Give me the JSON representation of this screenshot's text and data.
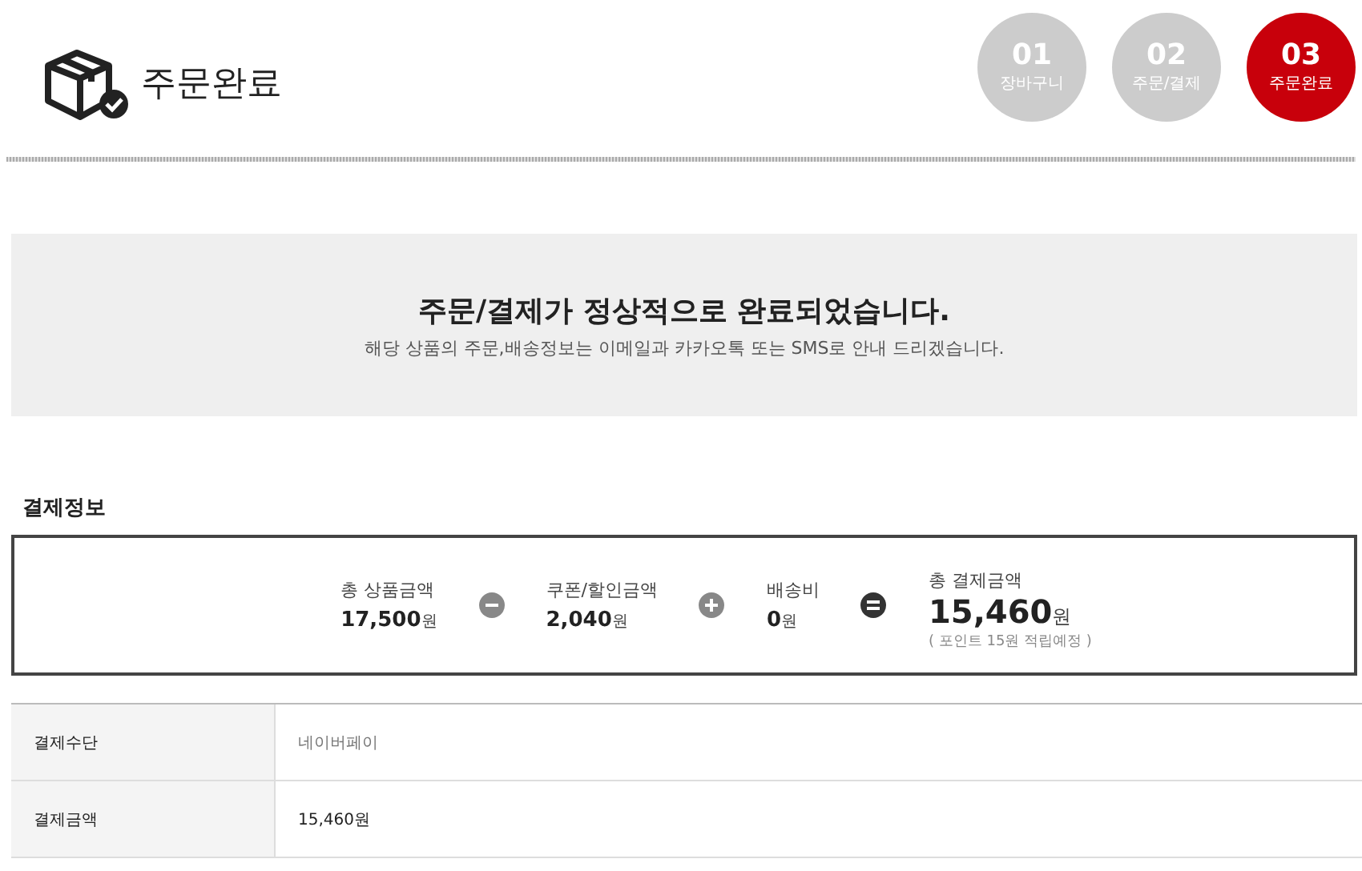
{
  "header": {
    "title": "주문완료"
  },
  "steps": [
    {
      "number": "01",
      "label": "장바구니",
      "selected": false
    },
    {
      "number": "02",
      "label": "주문/결제",
      "selected": false
    },
    {
      "number": "03",
      "label": "주문완료",
      "selected": true
    }
  ],
  "notice": {
    "heading": "주문/결제가 정상적으로 완료되었습니다.",
    "message": "해당 상품의 주문,배송정보는 이메일과 카카오톡 또는 SMS로 안내 드리겠습니다."
  },
  "section_title": "결제정보",
  "summary": [
    {
      "kind": "amount",
      "label": "총 상품금액",
      "value": "17,500",
      "unit": "원"
    },
    {
      "kind": "minus"
    },
    {
      "kind": "amount",
      "label": "쿠폰/할인금액",
      "value": "2,040",
      "unit": "원"
    },
    {
      "kind": "plus"
    },
    {
      "kind": "amount",
      "label": "배송비",
      "value": "0",
      "unit": "원"
    },
    {
      "kind": "equals"
    },
    {
      "kind": "total",
      "label": "총 결제금액",
      "value": "15,460",
      "unit": "원",
      "note": "( 포인트 15원 적립예정 )"
    }
  ],
  "table": {
    "rows": [
      {
        "label": "결제수단",
        "value": "네이버페이"
      },
      {
        "label": "결제금액",
        "value": "15,460원"
      }
    ]
  }
}
